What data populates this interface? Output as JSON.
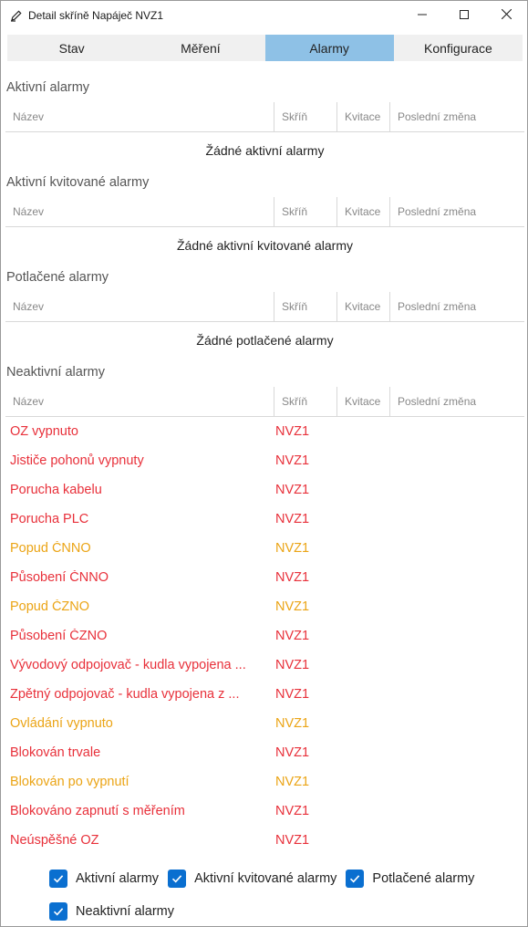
{
  "window": {
    "title": "Detail skříně Napáječ NVZ1"
  },
  "tabs": [
    {
      "label": "Stav"
    },
    {
      "label": "Měření"
    },
    {
      "label": "Alarmy"
    },
    {
      "label": "Konfigurace"
    }
  ],
  "columns": {
    "name": "Název",
    "box": "Skříň",
    "ack": "Kvitace",
    "last": "Poslední změna"
  },
  "sections": {
    "active": {
      "title": "Aktivní alarmy",
      "empty": "Žádné aktivní alarmy"
    },
    "acked": {
      "title": "Aktivní kvitované alarmy",
      "empty": "Žádné aktivní kvitované alarmy"
    },
    "suppressed": {
      "title": "Potlačené alarmy",
      "empty": "Žádné potlačené alarmy"
    },
    "inactive": {
      "title": "Neaktivní alarmy",
      "rows": [
        {
          "name": "OZ vypnuto",
          "box": "NVZ1",
          "color": "#e8303a"
        },
        {
          "name": "Jističe pohonů vypnuty",
          "box": "NVZ1",
          "color": "#e8303a"
        },
        {
          "name": "Porucha kabelu",
          "box": "NVZ1",
          "color": "#e8303a"
        },
        {
          "name": "Porucha PLC",
          "box": "NVZ1",
          "color": "#e8303a"
        },
        {
          "name": "Popud ČNNO",
          "box": "NVZ1",
          "color": "#eba415"
        },
        {
          "name": "Působení ČNNO",
          "box": "NVZ1",
          "color": "#e8303a"
        },
        {
          "name": "Popud ČZNO",
          "box": "NVZ1",
          "color": "#eba415"
        },
        {
          "name": "Působení ČZNO",
          "box": "NVZ1",
          "color": "#e8303a"
        },
        {
          "name": "Vývodový odpojovač - kudla vypojena ...",
          "box": "NVZ1",
          "color": "#e8303a"
        },
        {
          "name": "Zpětný odpojovač - kudla vypojena z ...",
          "box": "NVZ1",
          "color": "#e8303a"
        },
        {
          "name": "Ovládání vypnuto",
          "box": "NVZ1",
          "color": "#eba415"
        },
        {
          "name": "Blokován trvale",
          "box": "NVZ1",
          "color": "#e8303a"
        },
        {
          "name": "Blokován po vypnutí",
          "box": "NVZ1",
          "color": "#eba415"
        },
        {
          "name": "Blokováno zapnutí s měřením",
          "box": "NVZ1",
          "color": "#e8303a"
        },
        {
          "name": "Neúspěšné OZ",
          "box": "NVZ1",
          "color": "#e8303a"
        }
      ]
    }
  },
  "filters": [
    {
      "label": "Aktivní alarmy",
      "checked": true
    },
    {
      "label": "Aktivní kvitované alarmy",
      "checked": true
    },
    {
      "label": "Potlačené alarmy",
      "checked": true
    },
    {
      "label": "Neaktivní alarmy",
      "checked": true
    }
  ],
  "colors": {
    "accent": "#0a6fd0",
    "active_tab": "#8ec1e6",
    "alarm_red": "#e8303a",
    "alarm_orange": "#eba415"
  },
  "icons": {
    "app": "pencil-icon",
    "minimize": "minimize-icon",
    "maximize": "maximize-icon",
    "close": "close-icon",
    "checkbox": "check-icon"
  }
}
